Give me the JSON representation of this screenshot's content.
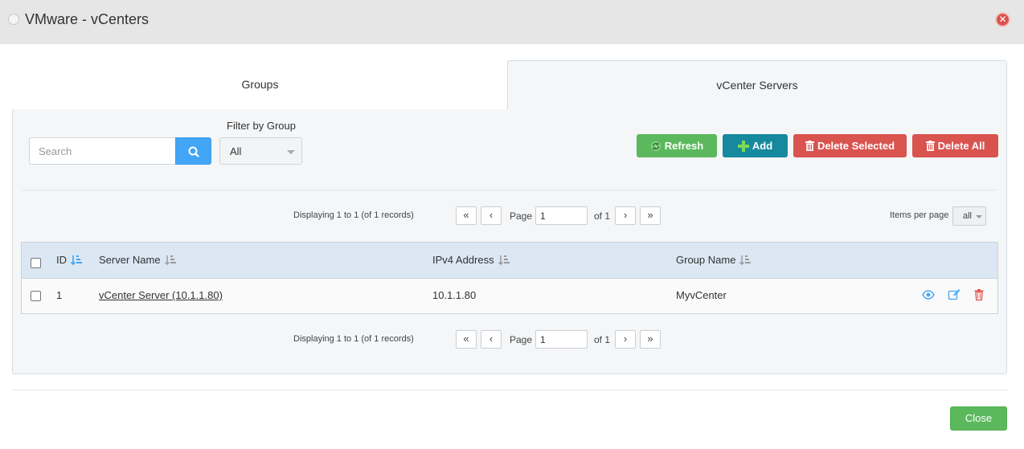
{
  "window": {
    "title": "VMware - vCenters"
  },
  "tabs": [
    {
      "label": "Groups",
      "active": false
    },
    {
      "label": "vCenter Servers",
      "active": true
    }
  ],
  "search": {
    "placeholder": "Search",
    "value": ""
  },
  "filter": {
    "label": "Filter by Group",
    "selected": "All"
  },
  "toolbar": {
    "refresh_label": "Refresh",
    "add_label": "Add",
    "delete_selected_label": "Delete Selected",
    "delete_all_label": "Delete All"
  },
  "pagination": {
    "summary": "Displaying 1 to 1 (of 1 records)",
    "page_label": "Page",
    "page_value": "1",
    "of_label": "of 1",
    "first": "«",
    "prev": "‹",
    "next": "›",
    "last": "»",
    "items_per_page_label": "Items per page",
    "items_per_page_value": "all"
  },
  "table": {
    "columns": [
      "ID",
      "Server Name",
      "IPv4 Address",
      "Group Name"
    ],
    "rows": [
      {
        "id": "1",
        "server_name": "vCenter Server (10.1.1.80)",
        "ipv4": "10.1.1.80",
        "group": "MyvCenter"
      }
    ]
  },
  "footer": {
    "close_label": "Close"
  },
  "colors": {
    "success": "#5cb85c",
    "info": "#17899e",
    "danger": "#d9534f",
    "primary": "#42a5f5",
    "header_row": "#dbe7f3"
  },
  "icons": [
    "window-icon",
    "close-icon",
    "search-icon",
    "refresh-icon",
    "plus-icon",
    "trash-icon",
    "sort-icon",
    "view-icon",
    "edit-icon",
    "delete-icon"
  ]
}
